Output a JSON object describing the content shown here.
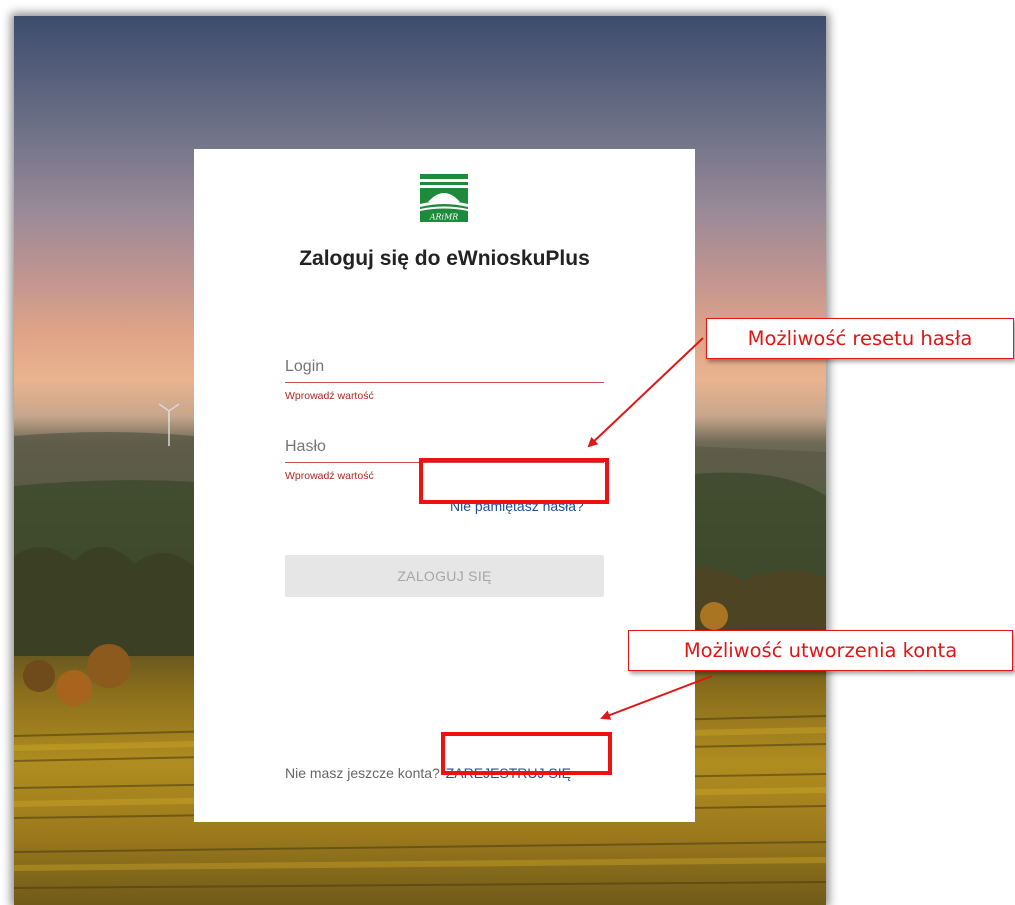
{
  "app": {
    "logo_text": "ARiMR",
    "title": "Zaloguj się do eWnioskuPlus"
  },
  "form": {
    "login_placeholder": "Login",
    "login_value": "",
    "login_error": "Wprowadź wartość",
    "password_placeholder": "Hasło",
    "password_value": "",
    "password_error": "Wprowadź wartość",
    "forgot_password": "Nie pamiętasz hasła?",
    "login_button": "ZALOGUJ SIĘ",
    "login_button_state": "disabled"
  },
  "register": {
    "prompt": "Nie masz jeszcze konta?",
    "link": "ZAREJESTRUJ SIĘ"
  },
  "annotations": {
    "reset_callout": "Możliwość resetu hasła",
    "register_callout": "Możliwość utworzenia konta"
  },
  "colors": {
    "annotation_red": "#e11616",
    "link_blue": "#1f4e9a",
    "error_red": "#b3261e",
    "logo_green": "#1e8a3c"
  }
}
